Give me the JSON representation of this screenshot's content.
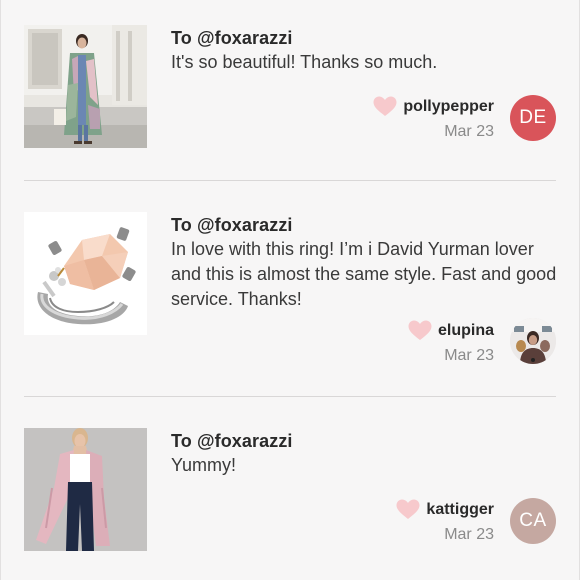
{
  "reviews": [
    {
      "to": "To @foxarazzi",
      "message": "It's so beautiful! Thanks so much.",
      "username": "pollypepper",
      "date": "Mar 23",
      "avatar_initials": "DE",
      "avatar_color": "#d9545a",
      "image": "woman-in-floral-coat-photo"
    },
    {
      "to": "To @foxarazzi",
      "message": "In love with this ring! I’m i David Yurman lover and this is almost the same style. Fast and good service. Thanks!",
      "username": "elupina",
      "date": "Mar 23",
      "avatar_initials": "",
      "avatar_color": "#8a7d78",
      "image": "rose-quartz-ring-photo"
    },
    {
      "to": "To @foxarazzi",
      "message": "Yummy!",
      "username": "kattigger",
      "date": "Mar 23",
      "avatar_initials": "CA",
      "avatar_color": "#c5a8a1",
      "image": "woman-in-pink-cardigan-photo"
    }
  ],
  "colors": {
    "heart": "#f7c9cc",
    "background": "#f7f6f6",
    "divider": "#d9d7d7"
  }
}
